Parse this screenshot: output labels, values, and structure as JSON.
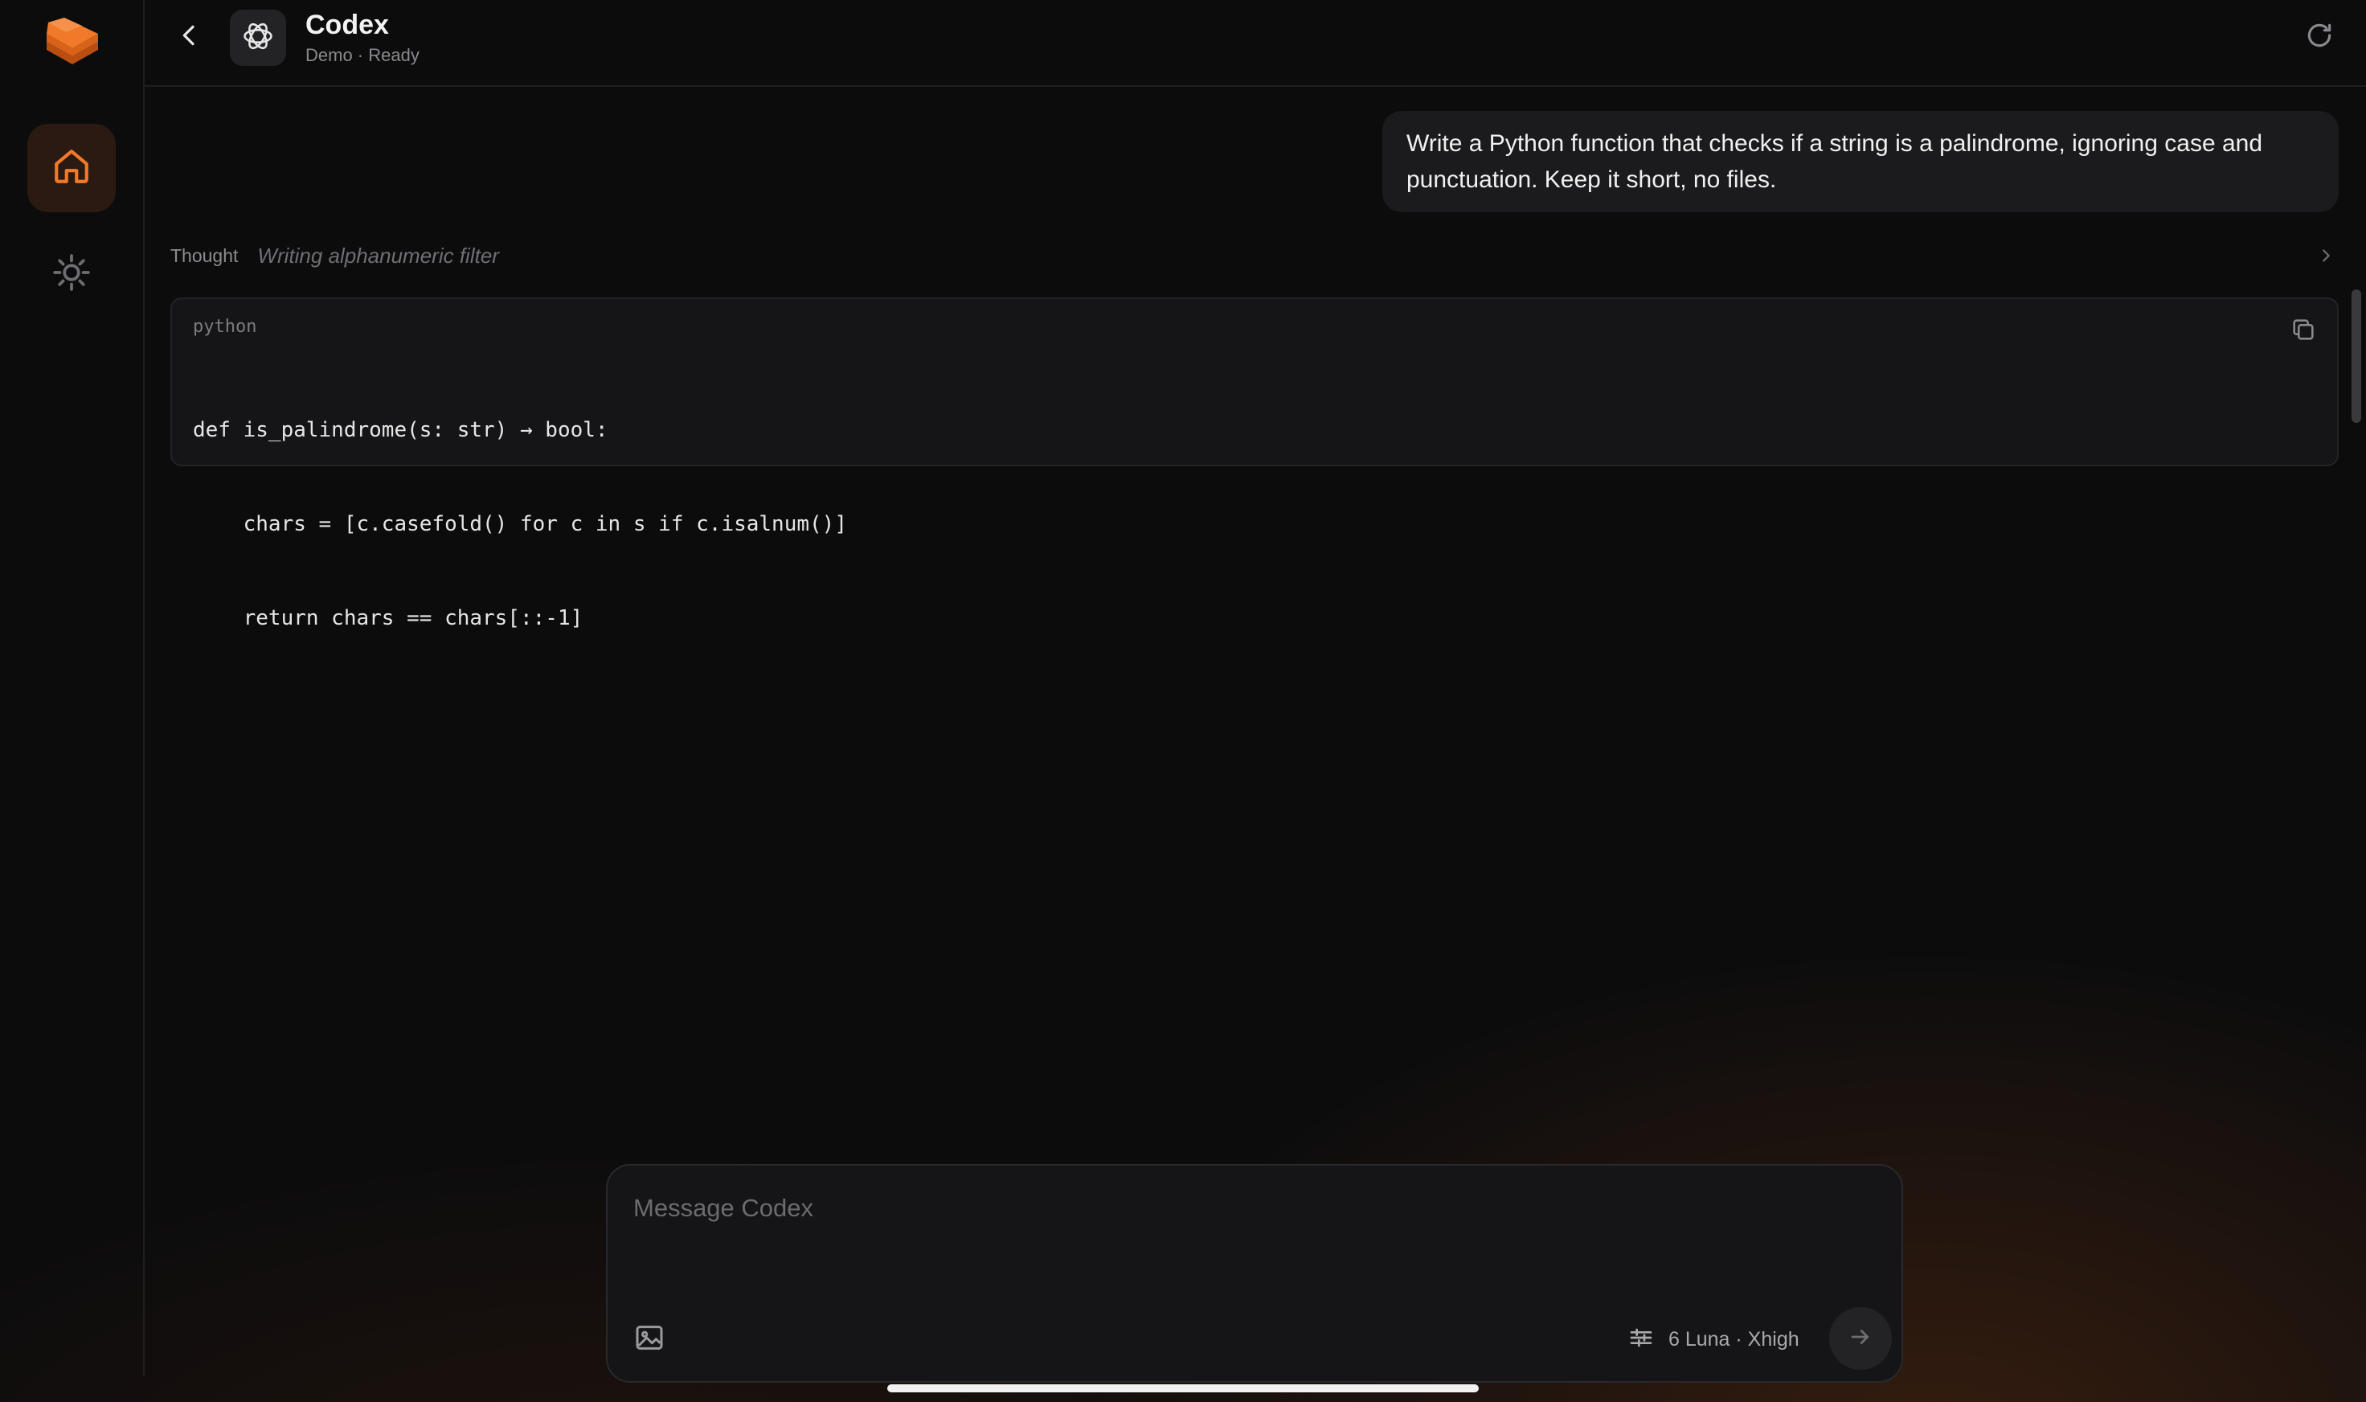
{
  "colors": {
    "accent": "#f07a2a",
    "background": "#0c0c0d",
    "surface": "#151517"
  },
  "sidebar": {
    "logo_icon": "stacked-books-icon",
    "items": [
      {
        "id": "home",
        "icon": "home-icon",
        "active": true
      },
      {
        "id": "settings",
        "icon": "gear-icon",
        "active": false
      }
    ]
  },
  "header": {
    "title": "Codex",
    "status": "Demo · Ready",
    "back_icon": "chevron-left-icon",
    "agent_icon": "openai-logo-icon",
    "refresh_icon": "refresh-icon"
  },
  "conversation": {
    "user_message": "Write a Python function that checks if a string is a palindrome, ignoring case and punctuation. Keep it short, no files.",
    "thought": {
      "label": "Thought",
      "text": "Writing alphanumeric filter"
    },
    "code_block": {
      "language": "python",
      "lines": [
        "def is_palindrome(s: str) → bool:",
        "    chars = [c.casefold() for c in s if c.isalnum()]",
        "    return chars == chars[::-1]"
      ]
    }
  },
  "composer": {
    "placeholder": "Message Codex",
    "value": "",
    "model_label": "6 Luna · Xhigh",
    "attach_icon": "image-icon",
    "settings_icon": "sliders-icon",
    "send_icon": "arrow-right-icon"
  }
}
